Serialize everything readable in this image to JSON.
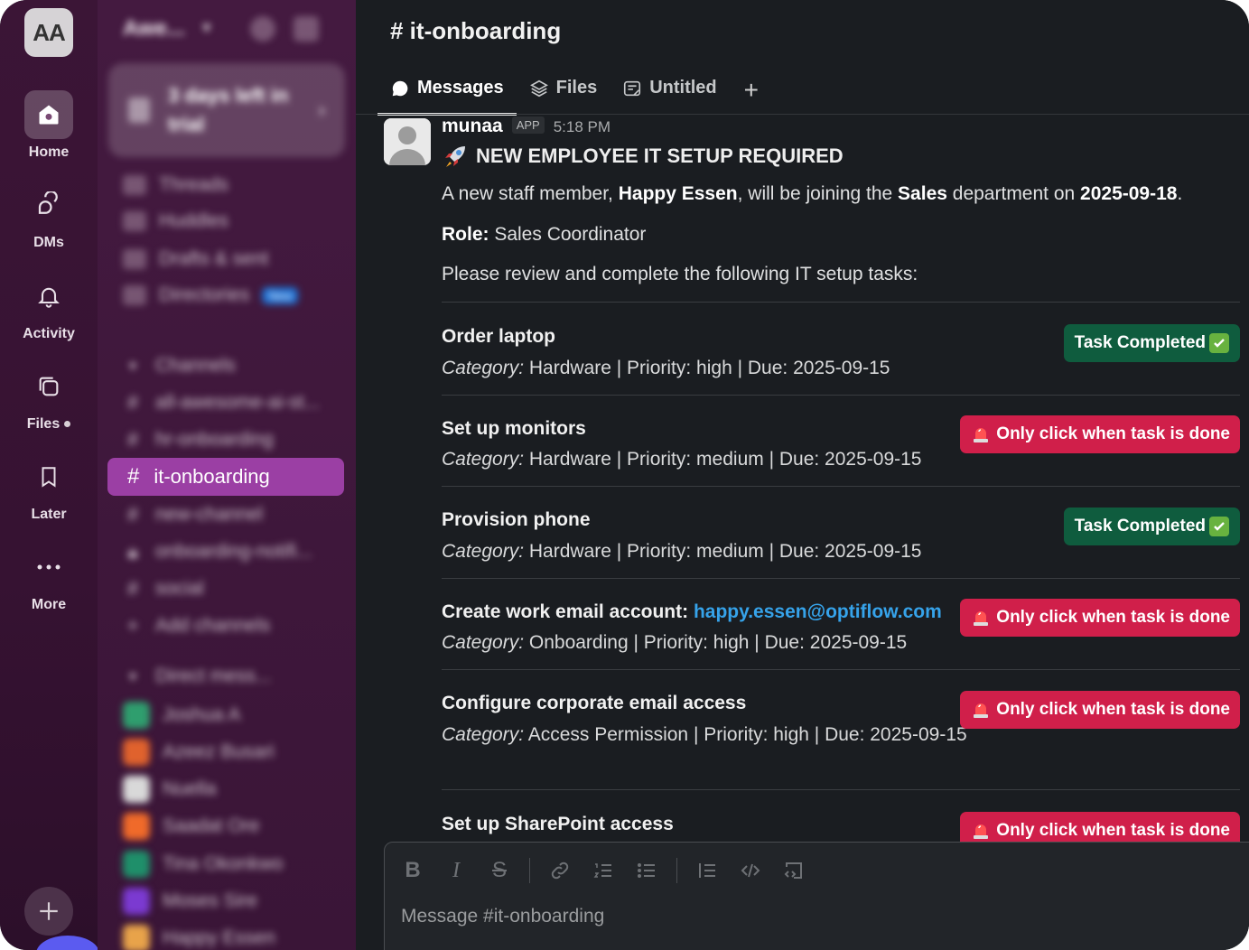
{
  "workspace": {
    "initials": "AA",
    "name": "Awe...",
    "trial_text": "3 days left in trial"
  },
  "rail": {
    "items": [
      {
        "label": "Home",
        "icon": "home-icon"
      },
      {
        "label": "DMs",
        "icon": "dms-icon"
      },
      {
        "label": "Activity",
        "icon": "bell-icon"
      },
      {
        "label": "Files",
        "icon": "files-icon"
      },
      {
        "label": "Later",
        "icon": "bookmark-icon"
      },
      {
        "label": "More",
        "icon": "more-icon"
      }
    ]
  },
  "sidebar": {
    "nav": [
      {
        "label": "Threads"
      },
      {
        "label": "Huddles"
      },
      {
        "label": "Drafts & sent"
      },
      {
        "label": "Directories",
        "badge": "New"
      }
    ],
    "channels_header": "Channels",
    "channels": [
      {
        "name": "all-awesome-ai-st..."
      },
      {
        "name": "hr-onboarding"
      },
      {
        "name": "it-onboarding"
      },
      {
        "name": "new-channel"
      },
      {
        "name": "onboarding-notifi..."
      },
      {
        "name": "social"
      }
    ],
    "add_channels": "Add channels",
    "dms_header": "Direct mess...",
    "dms": [
      {
        "name": "Joshua A",
        "color": "#2f9e6e"
      },
      {
        "name": "Azeez Busari",
        "color": "#e0622d"
      },
      {
        "name": "Nuella",
        "color": "#d9d9d9"
      },
      {
        "name": "Saadat Ore",
        "color": "#f06a2a"
      },
      {
        "name": "Tina Okonkwo",
        "color": "#1f8f6a"
      },
      {
        "name": "Moses Sire",
        "color": "#7b3ad1"
      },
      {
        "name": "Happy Essen",
        "color": "#e8a34a"
      }
    ]
  },
  "channel": {
    "title": "# it-onboarding",
    "tabs": [
      {
        "label": "Messages",
        "active": true
      },
      {
        "label": "Files"
      },
      {
        "label": "Untitled"
      }
    ],
    "add_tab": "+"
  },
  "message": {
    "author": "munaa",
    "badge": "APP",
    "time": "5:18 PM",
    "title": "NEW EMPLOYEE IT SETUP REQUIRED",
    "intro": {
      "p1": "A new staff member, ",
      "name": "Happy Essen",
      "p2": ", will be joining the ",
      "dept": "Sales",
      "p3": " department on ",
      "date": "2025-09-18",
      "p4": "."
    },
    "role_label": "Role:",
    "role_value": " Sales Coordinator",
    "instructions": "Please review and complete the following IT setup tasks:",
    "category_label": "Category:",
    "tasks": [
      {
        "title": "Order laptop",
        "meta": " Hardware | Priority: high | Due: 2025-09-15",
        "status": "Task Completed"
      },
      {
        "title": "Set up monitors",
        "meta": " Hardware | Priority: medium | Due: 2025-09-15",
        "status": "Only click when task is done"
      },
      {
        "title": "Provision phone",
        "meta": " Hardware | Priority: medium | Due: 2025-09-15",
        "status": "Task Completed"
      },
      {
        "title": "Create work email account: ",
        "link": "happy.essen@optiflow.com",
        "meta": " Onboarding | Priority: high | Due: 2025-09-15",
        "status": "Only click when task is done"
      },
      {
        "title": "Configure corporate email access",
        "meta": " Access Permission | Priority: high | Due: 2025-09-15",
        "status": "Only click when task is done"
      },
      {
        "title": "Set up SharePoint access",
        "status": "Only click when task is done"
      }
    ]
  },
  "composer": {
    "placeholder": "Message #it-onboarding"
  },
  "colors": {
    "rail_bg": "#3b1536",
    "sidebar_bg": "#441a40",
    "active_channel": "#9b3fa4",
    "done_button": "#0f5c3e",
    "pending_button": "#d01f4a",
    "link": "#36a3ea"
  }
}
